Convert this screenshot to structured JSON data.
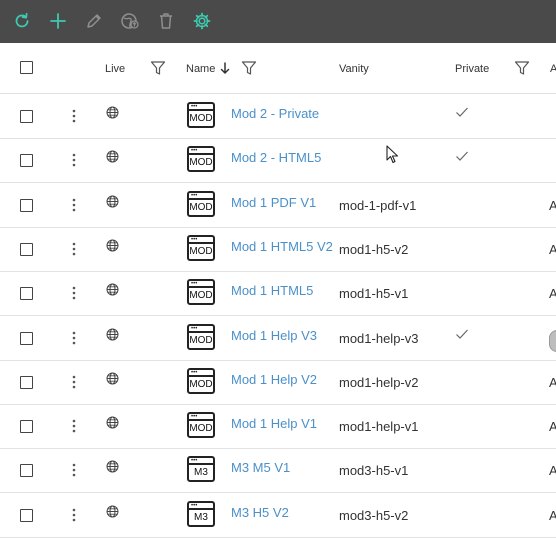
{
  "toolbar": {
    "icons": [
      "refresh-icon",
      "add-icon",
      "edit-icon",
      "publish-globe-icon",
      "delete-icon",
      "settings-gear-icon"
    ],
    "accent": "#3ec9b0",
    "muted": "#8f8f8f"
  },
  "header": {
    "live": "Live",
    "name": "Name",
    "vanity": "Vanity",
    "private": "Private",
    "cut": "A"
  },
  "rows": [
    {
      "thumb": "MOD",
      "name": "Mod 2 - Private",
      "vanity": "",
      "private": true,
      "edge": ""
    },
    {
      "thumb": "MOD",
      "name": "Mod 2 - HTML5",
      "vanity": "",
      "private": true,
      "edge": ""
    },
    {
      "thumb": "MOD",
      "name": "Mod 1 PDF V1",
      "vanity": "mod-1-pdf-v1",
      "private": false,
      "edge": "A"
    },
    {
      "thumb": "MOD",
      "name": "Mod 1 HTML5 V2",
      "vanity": "mod1-h5-v2",
      "private": false,
      "edge": "A"
    },
    {
      "thumb": "MOD",
      "name": "Mod 1 HTML5",
      "vanity": "mod1-h5-v1",
      "private": false,
      "edge": "A"
    },
    {
      "thumb": "MOD",
      "name": "Mod 1 Help V3",
      "vanity": "mod1-help-v3",
      "private": true,
      "edge": "avatar"
    },
    {
      "thumb": "MOD",
      "name": "Mod 1 Help V2",
      "vanity": "mod1-help-v2",
      "private": false,
      "edge": "A"
    },
    {
      "thumb": "MOD",
      "name": "Mod 1 Help V1",
      "vanity": "mod1-help-v1",
      "private": false,
      "edge": "A"
    },
    {
      "thumb": "M3",
      "name": "M3 M5 V1",
      "vanity": "mod3-h5-v1",
      "private": false,
      "edge": "A"
    },
    {
      "thumb": "M3",
      "name": "M3 H5 V2",
      "vanity": "mod3-h5-v2",
      "private": false,
      "edge": "A"
    }
  ]
}
